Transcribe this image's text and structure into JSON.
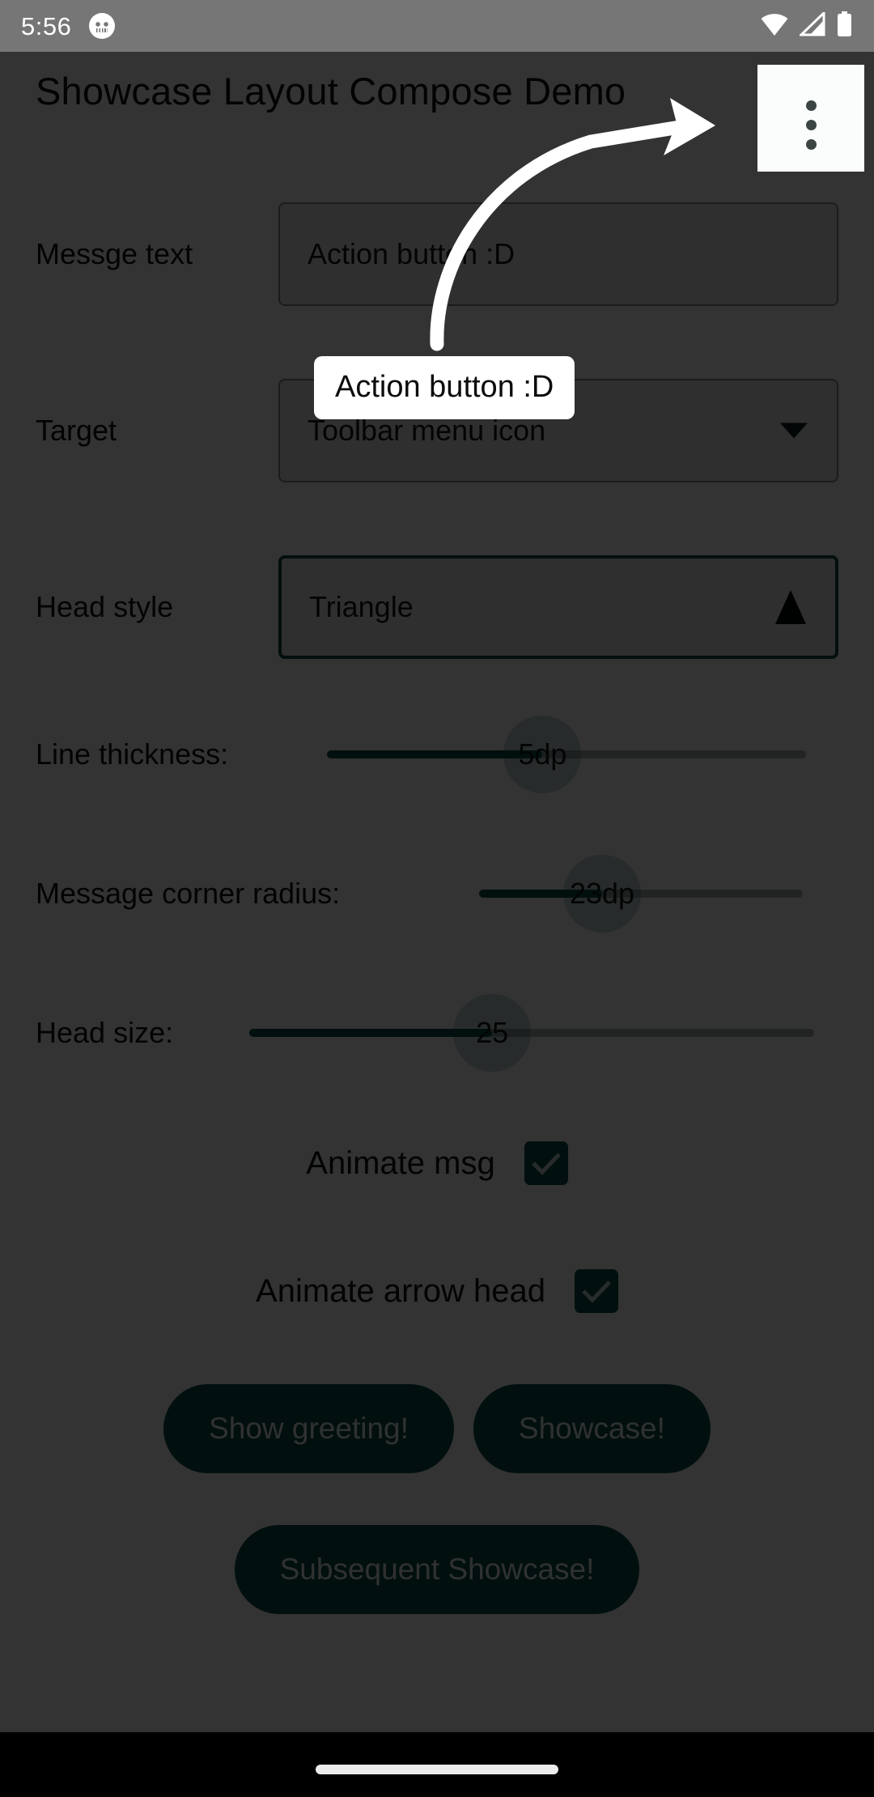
{
  "status_bar": {
    "time": "5:56",
    "app_icon": "android-robot-icon",
    "icons": [
      "wifi-icon",
      "cellular-signal-icon",
      "battery-icon"
    ]
  },
  "app_bar": {
    "title": "Showcase Layout Compose Demo",
    "overflow_menu": "overflow-menu-icon"
  },
  "form": {
    "message_text": {
      "label": "Messge text",
      "value": "Action button :D"
    },
    "target": {
      "label": "Target",
      "value": "Toolbar menu icon",
      "caret": "chevron-down-icon"
    },
    "head_style": {
      "label": "Head style",
      "value": "Triangle",
      "caret": "triangle-up-icon",
      "focused": true
    },
    "line_thickness": {
      "label": "Line thickness:",
      "value": "5dp",
      "percent": 45
    },
    "message_corner_radius": {
      "label": "Message corner radius:",
      "value": "23dp",
      "percent": 38
    },
    "head_size": {
      "label": "Head size:",
      "value": "25",
      "percent": 43
    },
    "animate_msg": {
      "label": "Animate msg",
      "checked": true,
      "icon": "check-icon"
    },
    "animate_arrow_head": {
      "label": "Animate arrow head",
      "checked": true,
      "icon": "check-icon"
    }
  },
  "buttons": {
    "show_greeting": "Show greeting!",
    "showcase": "Showcase!",
    "subsequent_showcase": "Subsequent Showcase!"
  },
  "showcase": {
    "tooltip_text": "Action button :D",
    "arrow": "curved-arrow-icon",
    "arrow_color": "#ffffff",
    "scrim_color": "#000000"
  },
  "nav_bar": {
    "gesture_pill": "home-gesture-pill"
  },
  "colors": {
    "accent": "#0a4e4b",
    "status_bar_bg": "#767676",
    "app_bg": "#fafdfb",
    "tooltip_bg": "#ffffff"
  }
}
